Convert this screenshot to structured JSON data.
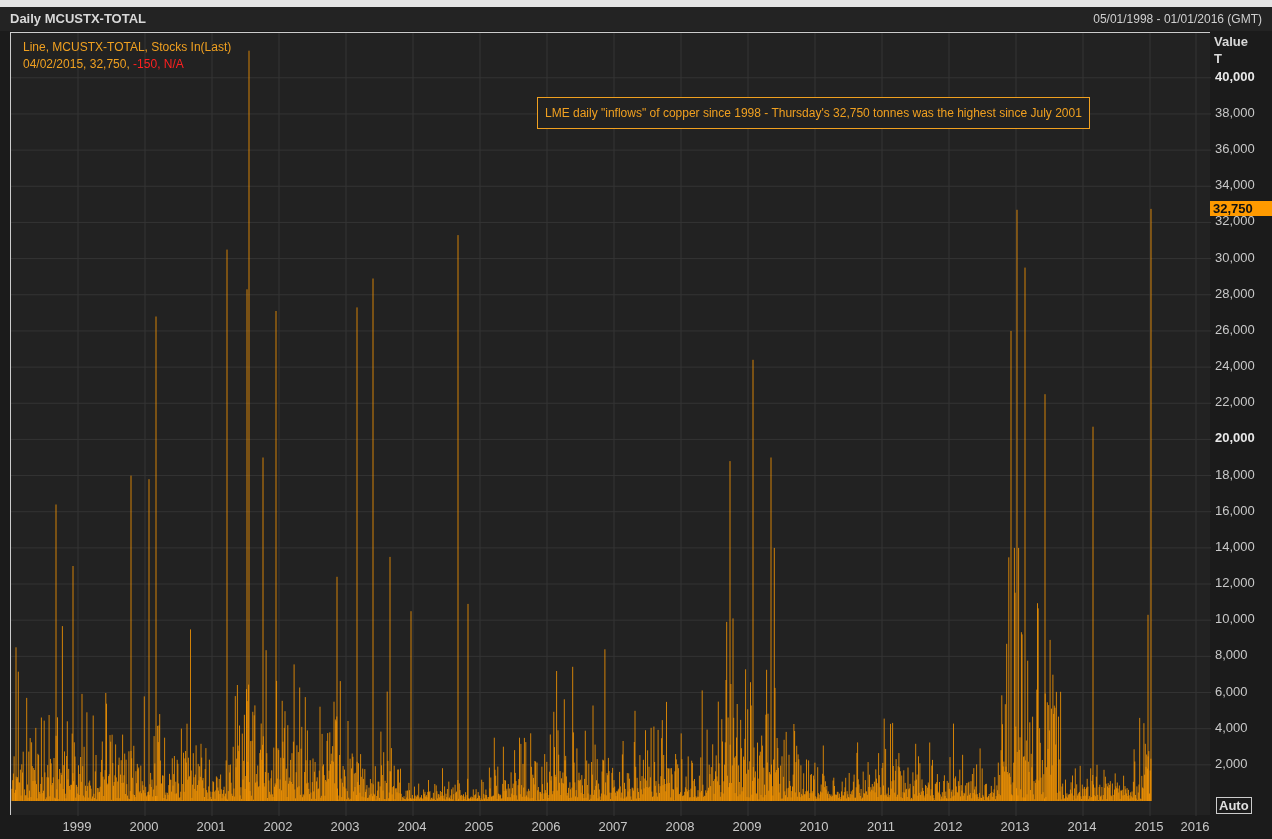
{
  "header": {
    "title": "Daily MCUSTX-TOTAL",
    "range": "05/01/1998 - 01/01/2016 (GMT)"
  },
  "legend": {
    "title": "Line, MCUSTX-TOTAL, Stocks In(Last)",
    "readout": [
      {
        "text": "04/02/2015, 32,750, ",
        "negative": false
      },
      {
        "text": "-150, N/A",
        "negative": true
      }
    ]
  },
  "annotation": "LME daily \"inflows\" of copper since 1998 - Thursday's 32,750 tonnes was the highest since July 2001",
  "y_axis": {
    "title": "Value",
    "unit": "T",
    "last_value": "32,750",
    "ticks": [
      {
        "label": "40,000",
        "major": true
      },
      {
        "label": "38,000",
        "major": false
      },
      {
        "label": "36,000",
        "major": false
      },
      {
        "label": "34,000",
        "major": false
      },
      {
        "label": "32,000",
        "major": false
      },
      {
        "label": "30,000",
        "major": false
      },
      {
        "label": "28,000",
        "major": false
      },
      {
        "label": "26,000",
        "major": false
      },
      {
        "label": "24,000",
        "major": false
      },
      {
        "label": "22,000",
        "major": false
      },
      {
        "label": "20,000",
        "major": true
      },
      {
        "label": "18,000",
        "major": false
      },
      {
        "label": "16,000",
        "major": false
      },
      {
        "label": "14,000",
        "major": false
      },
      {
        "label": "12,000",
        "major": false
      },
      {
        "label": "10,000",
        "major": false
      },
      {
        "label": "8,000",
        "major": false
      },
      {
        "label": "6,000",
        "major": false
      },
      {
        "label": "4,000",
        "major": false
      },
      {
        "label": "2,000",
        "major": false
      }
    ]
  },
  "x_axis": {
    "ticks": [
      "1999",
      "2000",
      "2001",
      "2002",
      "2003",
      "2004",
      "2005",
      "2006",
      "2007",
      "2008",
      "2009",
      "2010",
      "2011",
      "2012",
      "2013",
      "2014",
      "2015",
      "2016"
    ]
  },
  "scale_button": "Auto"
}
